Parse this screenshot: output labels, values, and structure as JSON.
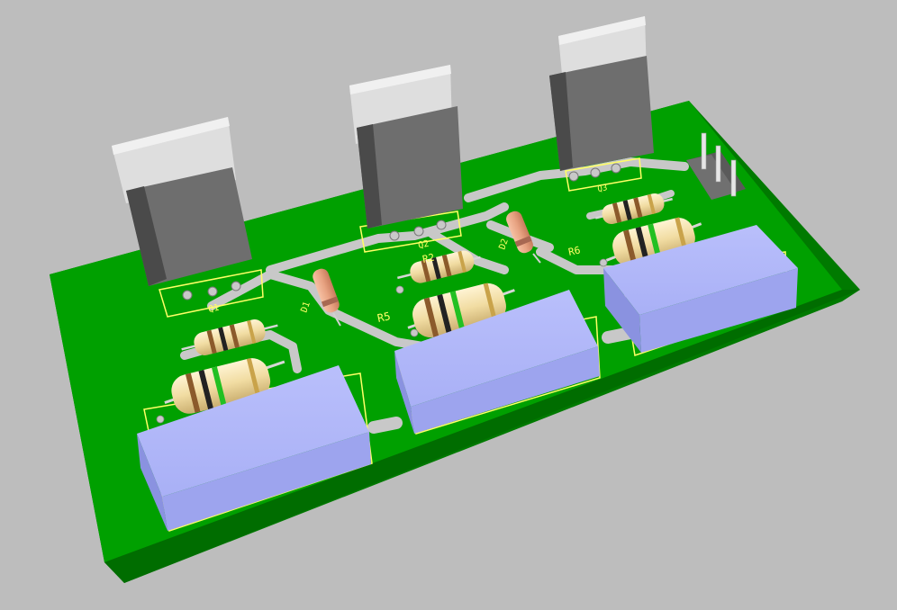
{
  "scene": {
    "labels": {
      "q1": "Q1",
      "q2": "Q2",
      "q3": "Q3",
      "d1": "D1",
      "d2": "D2",
      "r2": "R2",
      "r5": "R5",
      "r6": "R6"
    },
    "colors": {
      "background": "#bdbdbd",
      "pcb": "#00a000",
      "pcb_edge": "#007a00",
      "trace": "#c8c8c8",
      "silkscreen": "#ffff66",
      "transistor_body": "#6b6b6b",
      "transistor_tab": "#d9d9d9",
      "relay_body": "#aab0f5",
      "resistor_body": "#f2dca0",
      "diode_body": "#e8a382"
    }
  }
}
